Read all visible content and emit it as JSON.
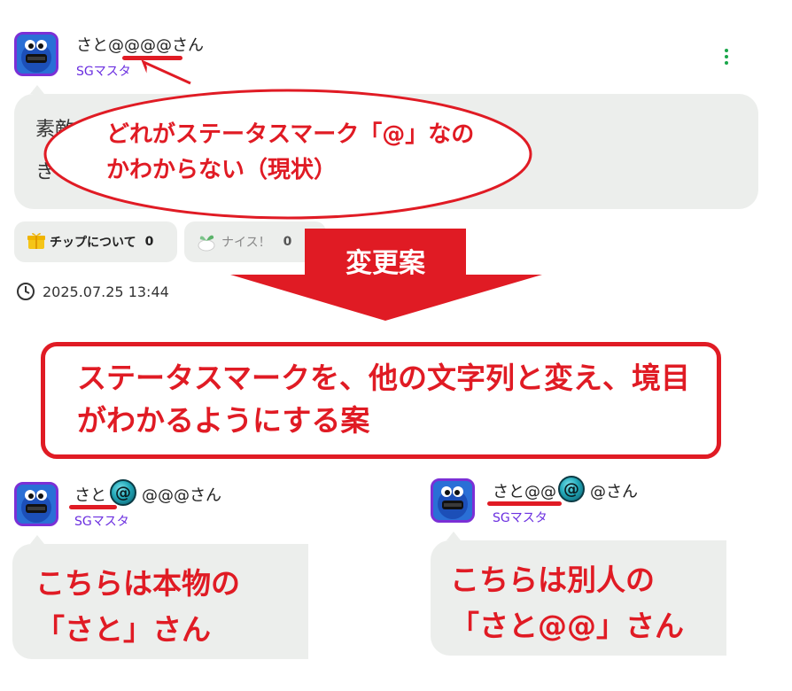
{
  "post": {
    "username": "さと@@@@さん",
    "user_title": "SGマスタ",
    "body_line1": "素敵",
    "body_line2": "き",
    "tip_label": "チップについて",
    "tip_count": "0",
    "nice_label": "ナイス！",
    "nice_count": "0",
    "timestamp": "2025.07.25 13:44"
  },
  "annotations": {
    "ellipse_text": "どれがステータスマーク「@」なのかわからない（現状）",
    "arrow_label": "変更案",
    "proposal_text": "ステータスマークを、他の文字列と変え、境目がわかるようにする案"
  },
  "example_left": {
    "name_before": "さと",
    "name_after": "@@@さん",
    "status_mark": "@",
    "user_title": "SGマスタ",
    "caption_line1": "こちらは本物の",
    "caption_line2": "「さと」さん"
  },
  "example_right": {
    "name_before": "さと@@",
    "name_after": "@さん",
    "status_mark": "@",
    "user_title": "SGマスタ",
    "caption_line1": "こちらは別人の",
    "caption_line2": "「さと@@」さん"
  },
  "colors": {
    "accent_red": "#e01b24",
    "title_purple": "#6b2fe0",
    "bubble_gray": "#eceeec",
    "kebab_green": "#1aa64a"
  },
  "icons": [
    "kebab-menu-icon",
    "gift-icon",
    "nice-sprout-icon",
    "clock-icon",
    "avatar-cookie-monster"
  ]
}
